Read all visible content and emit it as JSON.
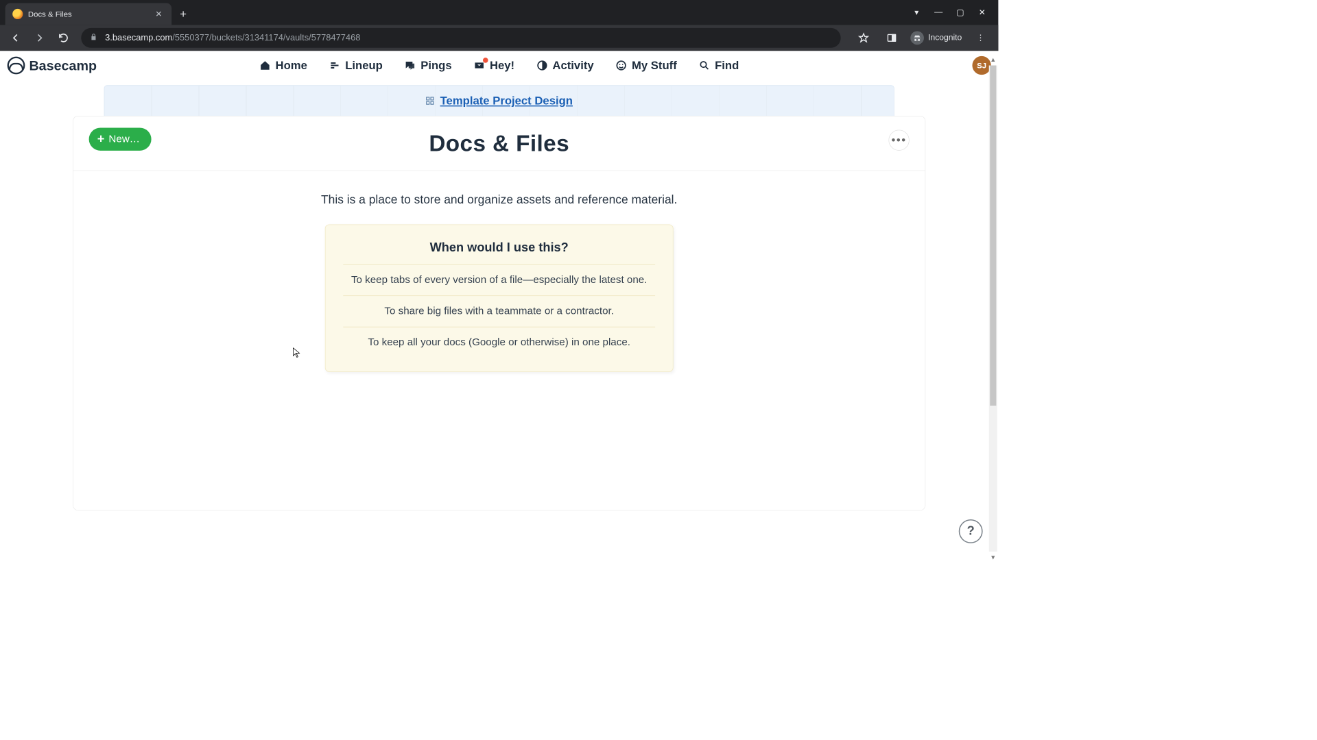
{
  "browser": {
    "tab_title": "Docs & Files",
    "url_host": "3.basecamp.com",
    "url_path": "/5550377/buckets/31341174/vaults/5778477468",
    "incognito_label": "Incognito"
  },
  "nav": {
    "brand": "Basecamp",
    "items": {
      "home": "Home",
      "lineup": "Lineup",
      "pings": "Pings",
      "hey": "Hey!",
      "activity": "Activity",
      "mystuff": "My Stuff",
      "find": "Find"
    },
    "avatar_initials": "SJ"
  },
  "project": {
    "name": "Template Project Design"
  },
  "sheet": {
    "new_label": "New…",
    "title": "Docs & Files",
    "subtitle": "This is a place to store and organize assets and reference material.",
    "tip_title": "When would I use this?",
    "tips": [
      "To keep tabs of every version of a file—especially the latest one.",
      "To share big files with a teammate or a contractor.",
      "To keep all your docs (Google or otherwise) in one place."
    ]
  },
  "help": {
    "label": "?"
  }
}
